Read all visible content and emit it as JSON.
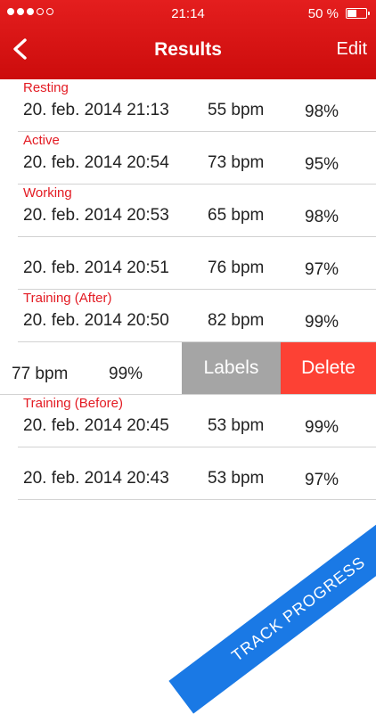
{
  "status": {
    "time": "21:14",
    "battery": "50 %",
    "battery_level": 0.5,
    "signal_dots": [
      1,
      1,
      1,
      0,
      0
    ]
  },
  "nav": {
    "title": "Results",
    "edit": "Edit"
  },
  "rows": [
    {
      "label": "Resting",
      "date": "20. feb. 2014 21:13",
      "bpm": "55 bpm",
      "pct": "98%"
    },
    {
      "label": "Active",
      "date": "20. feb. 2014 20:54",
      "bpm": "73 bpm",
      "pct": "95%"
    },
    {
      "label": "Working",
      "date": "20. feb. 2014 20:53",
      "bpm": "65 bpm",
      "pct": "98%"
    },
    {
      "label": "",
      "date": "20. feb. 2014 20:51",
      "bpm": "76 bpm",
      "pct": "97%"
    },
    {
      "label": "Training (After)",
      "date": "20. feb. 2014 20:50",
      "bpm": "82 bpm",
      "pct": "99%"
    }
  ],
  "swiped_row": {
    "bpm": "77 bpm",
    "pct": "99%",
    "labels_button": "Labels",
    "delete_button": "Delete"
  },
  "rows_after": [
    {
      "label": "Training (Before)",
      "date": "20. feb. 2014 20:45",
      "bpm": "53 bpm",
      "pct": "99%"
    },
    {
      "label": "",
      "date": "20. feb. 2014 20:43",
      "bpm": "53 bpm",
      "pct": "97%"
    }
  ],
  "banner": "TRACK PROGRESS",
  "colors": {
    "header": "#d81414",
    "label": "#e31b23",
    "delete": "#fd4134",
    "labels_btn": "#a5a5a5",
    "banner": "#1a79e5"
  }
}
